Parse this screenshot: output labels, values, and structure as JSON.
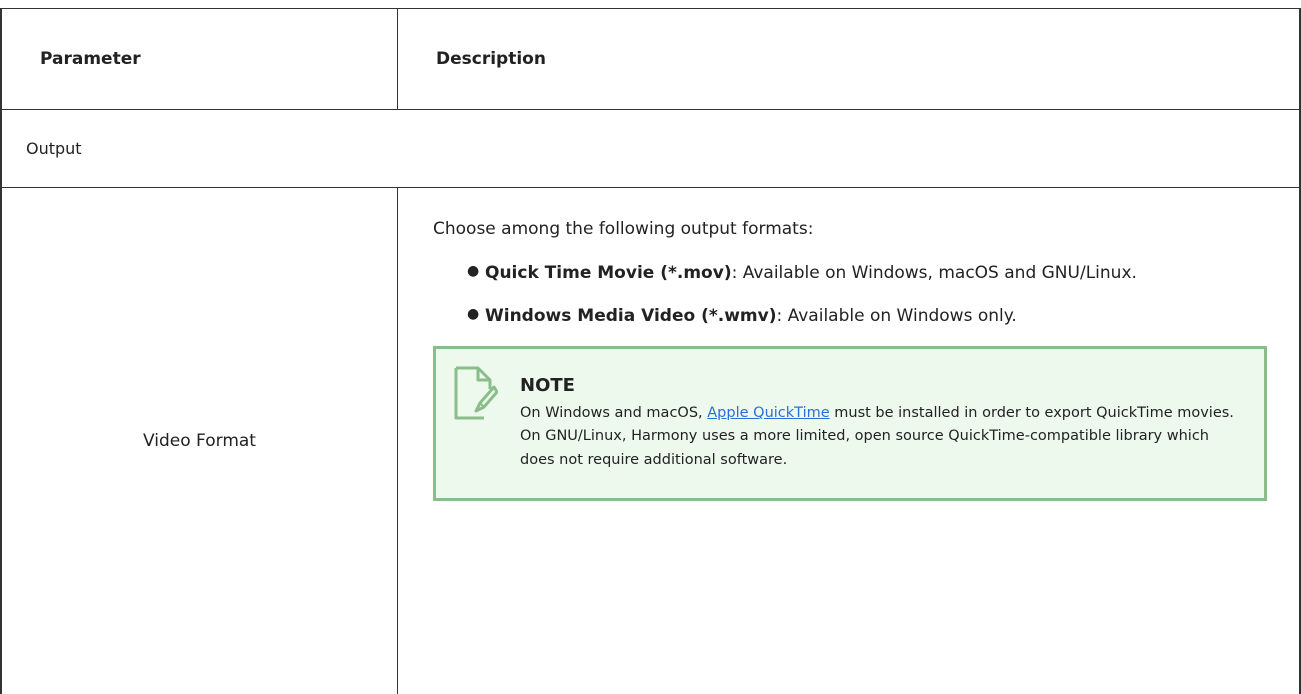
{
  "table": {
    "header": {
      "parameter": "Parameter",
      "description": "Description"
    },
    "section": "Output",
    "row": {
      "parameter": "Video Format",
      "intro": "Choose among the following output formats:",
      "formats": [
        {
          "name": "Quick Time Movie (*.mov)",
          "detail": ": Available on Windows, macOS and GNU/Linux."
        },
        {
          "name": "Windows Media Video (*.wmv)",
          "detail": ": Available on Windows only."
        }
      ],
      "note": {
        "icon": "note-pencil-icon",
        "title": "NOTE",
        "text_before": "On Windows and macOS, ",
        "link": "Apple QuickTime",
        "text_after": " must be installed in order to export QuickTime movies. On GNU/Linux, Harmony uses a more limited, open source QuickTime-compatible library which does not require additional software."
      }
    }
  },
  "colors": {
    "note_background": "#eef9ee",
    "note_border": "#8bbd8b",
    "link": "#2a6fd6",
    "table_border": "#333333"
  }
}
